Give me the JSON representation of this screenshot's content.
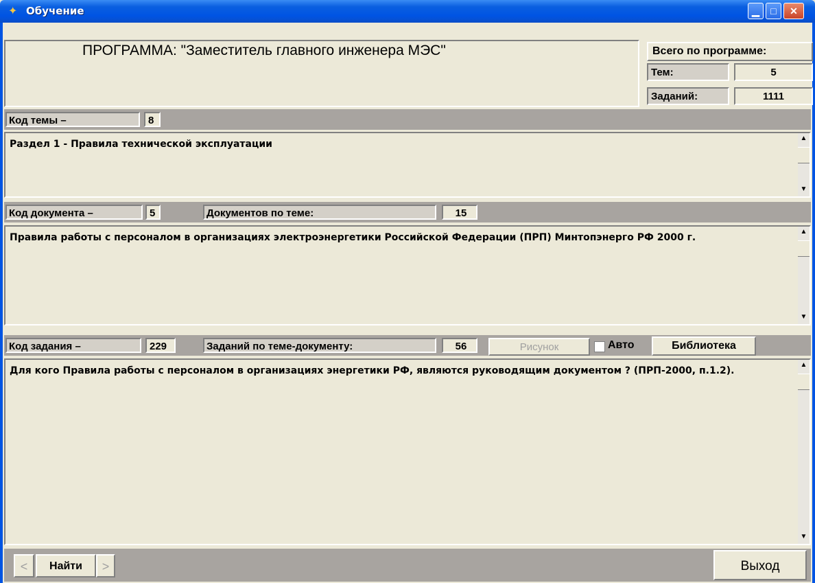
{
  "window": {
    "title": "Обучение",
    "icon": "yellow-sparkle-icon",
    "controls": [
      "minimize",
      "maximize",
      "close"
    ]
  },
  "program": {
    "title": "ПРОГРАММА: \"Заместитель главного инженера  МЭС\""
  },
  "stats": {
    "header": "Всего по программе:",
    "topics_label": "Тем:",
    "topics_value": "5",
    "tasks_label": "Заданий:",
    "tasks_value": "1111"
  },
  "topic": {
    "code_label": "Код темы –",
    "code_value": "8",
    "text": "Раздел 1 - Правила технической эксплуатации"
  },
  "document": {
    "code_label": "Код документа –",
    "code_value": "5",
    "count_label": "Документов по теме:",
    "count_value": "15",
    "text": "Правила  работы с персоналом  в организациях электроэнергетики Российской Федерации (ПРП) Минтопэнерго РФ 2000 г."
  },
  "task": {
    "code_label": "Код задания –",
    "code_value": "229",
    "count_label": "Заданий по теме-документу:",
    "count_value": "56",
    "picture_button": "Рисунок",
    "auto_label": "Авто",
    "library_button": "Библиотека",
    "text": "Для кого Правила работы с персоналом  в организациях энергетики РФ, являются руководящим документом ? (ПРП-2000, п.1.2)."
  },
  "footer": {
    "prev_label": "<",
    "find_label": "Найти",
    "next_label": ">",
    "exit_label": "Выход"
  }
}
